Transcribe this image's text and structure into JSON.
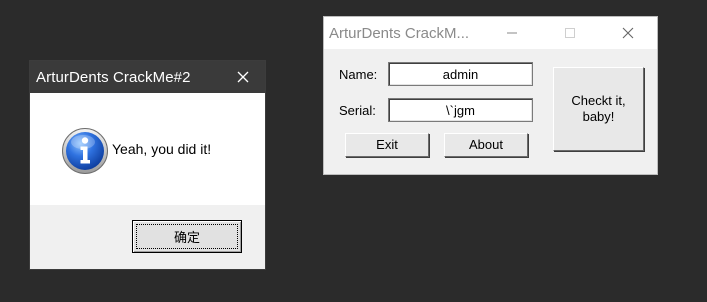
{
  "message_box": {
    "title": "ArturDents CrackMe#2",
    "message": "Yeah, you did it!",
    "ok_label": "确定"
  },
  "crackme_window": {
    "title": "ArturDents CrackM...",
    "name_label": "Name:",
    "name_value": "admin",
    "serial_label": "Serial:",
    "serial_value": "\\`jgm",
    "exit_label": "Exit",
    "about_label": "About",
    "check_label_line1": "Checkt it,",
    "check_label_line2": "baby!"
  },
  "colors": {
    "desktop": "#2b2b2b",
    "dialog_titlebar": "#3a3a3a",
    "window_face": "#f0f0f0",
    "info_icon": "#2a6ad8"
  }
}
